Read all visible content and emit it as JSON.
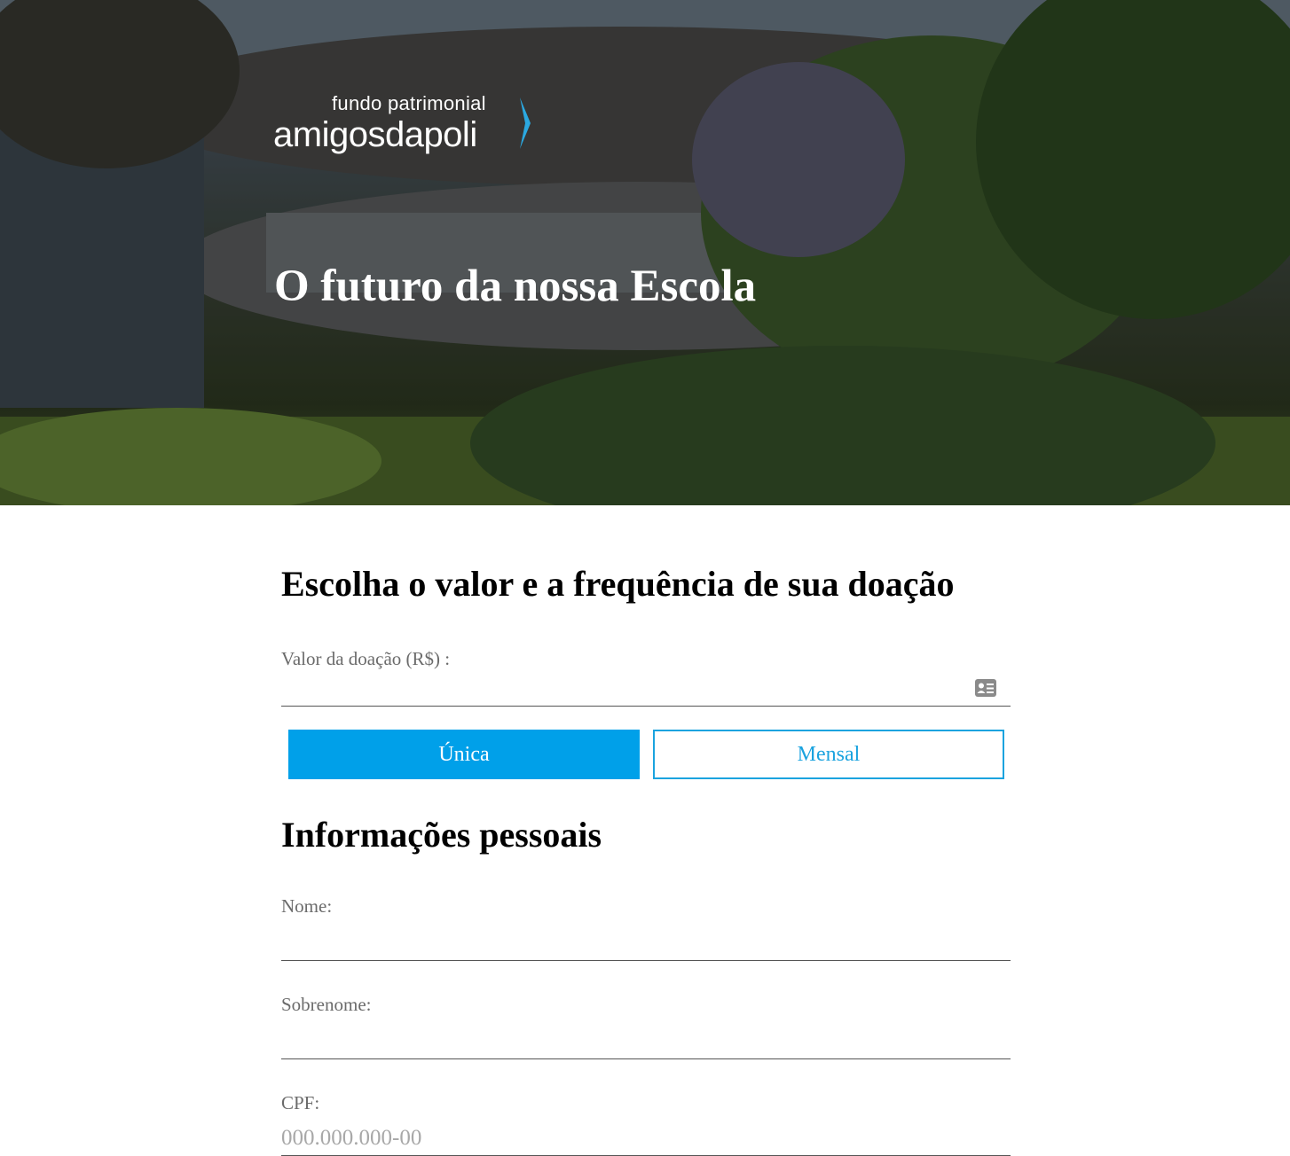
{
  "hero": {
    "logo_small": "fundo patrimonial",
    "logo_big": "amigosdapoli",
    "title": "O futuro da nossa Escola"
  },
  "donation": {
    "heading": "Escolha o valor e a frequência de sua doação",
    "amount_label": "Valor da doação (R$) :",
    "amount_value": "",
    "amount_icon": "card-icon",
    "options": [
      {
        "label": "Única",
        "selected": true
      },
      {
        "label": "Mensal",
        "selected": false
      }
    ]
  },
  "personal": {
    "heading": "Informações pessoais",
    "name_label": "Nome:",
    "name_value": "",
    "surname_label": "Sobrenome:",
    "surname_value": "",
    "cpf_label": "CPF:",
    "cpf_placeholder": "000.000.000-00"
  },
  "colors": {
    "accent": "#00a0e9",
    "accent_border": "#1aa3df",
    "label": "#6b6b6b"
  }
}
